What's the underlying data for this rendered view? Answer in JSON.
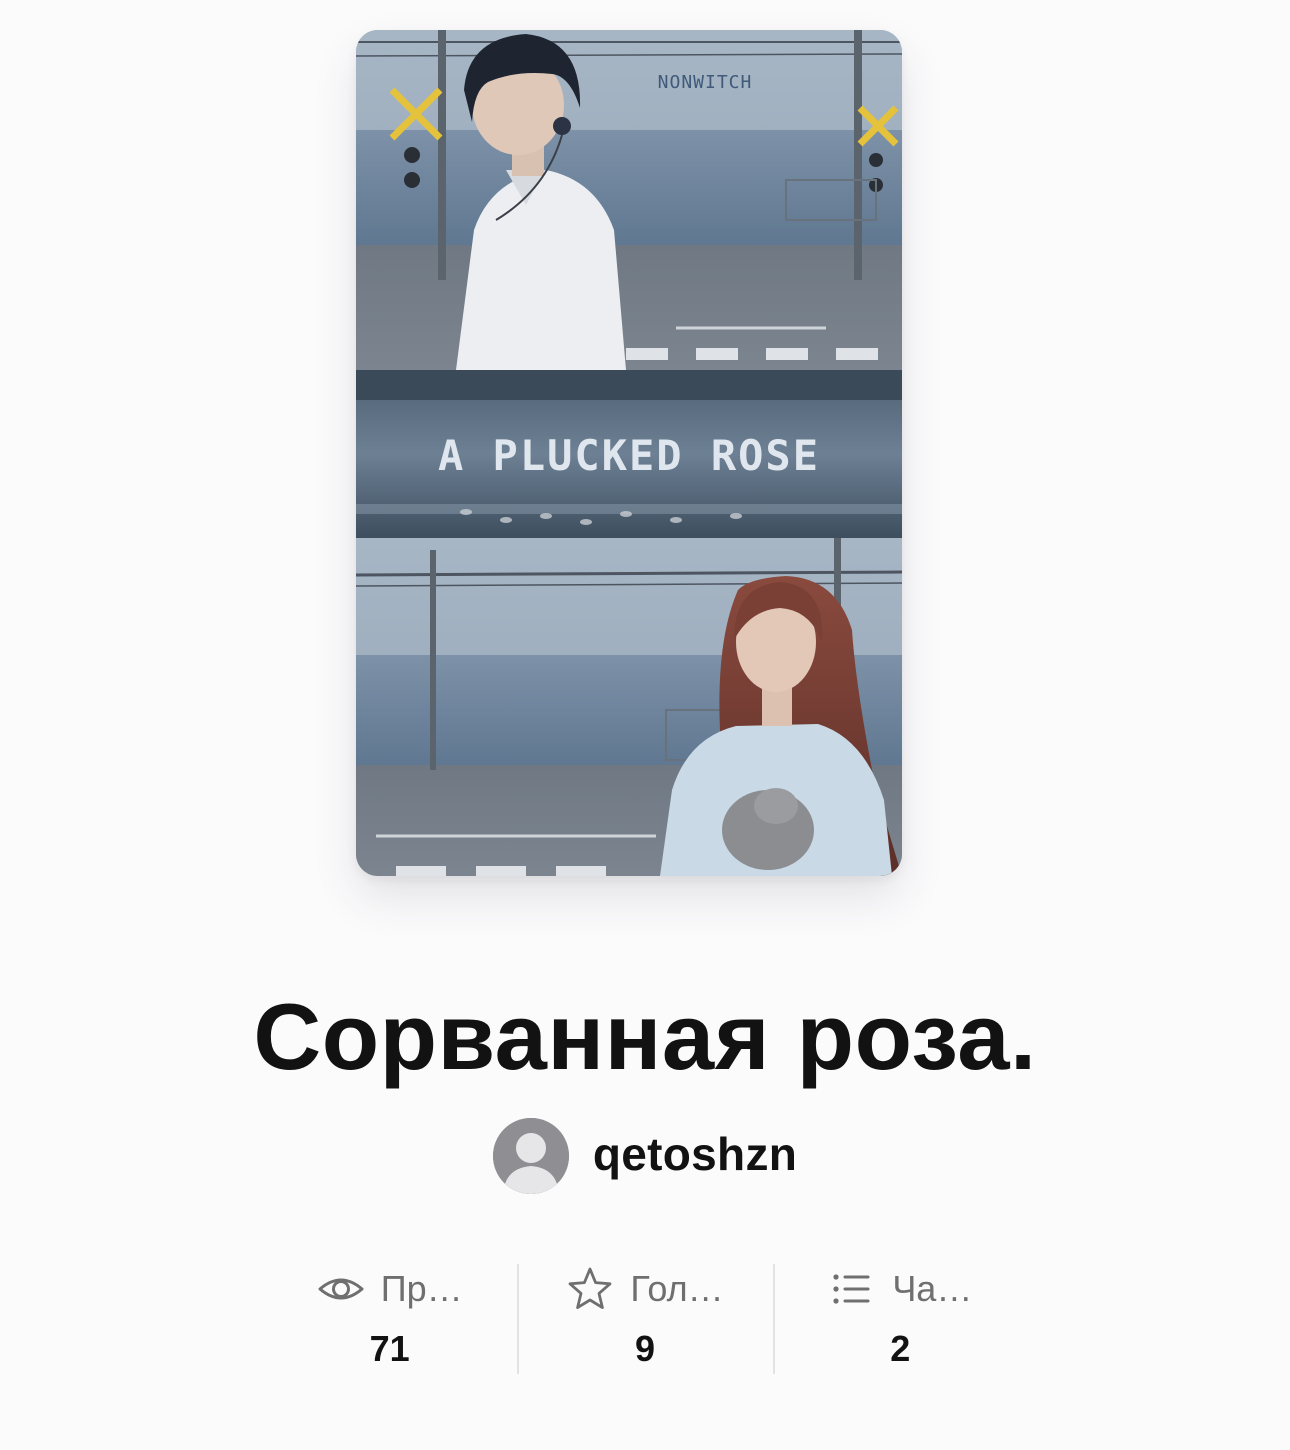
{
  "story": {
    "cover": {
      "image_title": "A PLUCKED ROSE",
      "watermark": "NONWITCH"
    },
    "title": "Сорванная роза.",
    "author": {
      "name": "qetoshzn",
      "avatar_icon": "default-user-avatar-icon"
    }
  },
  "stats": [
    {
      "icon": "eye-icon",
      "label": "Пр…",
      "value": "71"
    },
    {
      "icon": "star-icon",
      "label": "Гол…",
      "value": "9"
    },
    {
      "icon": "list-icon",
      "label": "Ча…",
      "value": "2"
    }
  ],
  "colors": {
    "background": "#fcfbfc",
    "text_primary": "#121212",
    "text_secondary": "#6f6f6f",
    "divider": "#e3e3e6",
    "avatar_bg": "#8f8f93"
  }
}
